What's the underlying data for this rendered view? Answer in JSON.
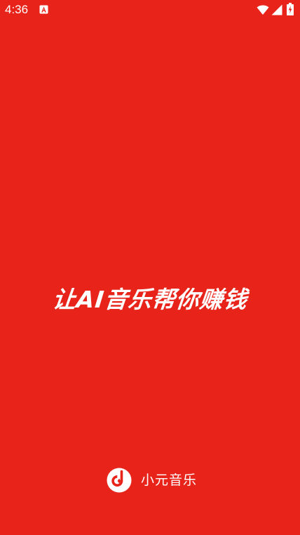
{
  "status_bar": {
    "time": "4:36",
    "icons": [
      "notification-app-icon",
      "wifi-icon",
      "signal-icon",
      "battery-charging-icon"
    ]
  },
  "splash": {
    "slogan": "让AI音乐帮你赚钱",
    "brand_name": "小元音乐",
    "logo_icon": "music-disc-logo-icon"
  },
  "colors": {
    "background": "#E8231A",
    "foreground": "#FFFFFF"
  }
}
